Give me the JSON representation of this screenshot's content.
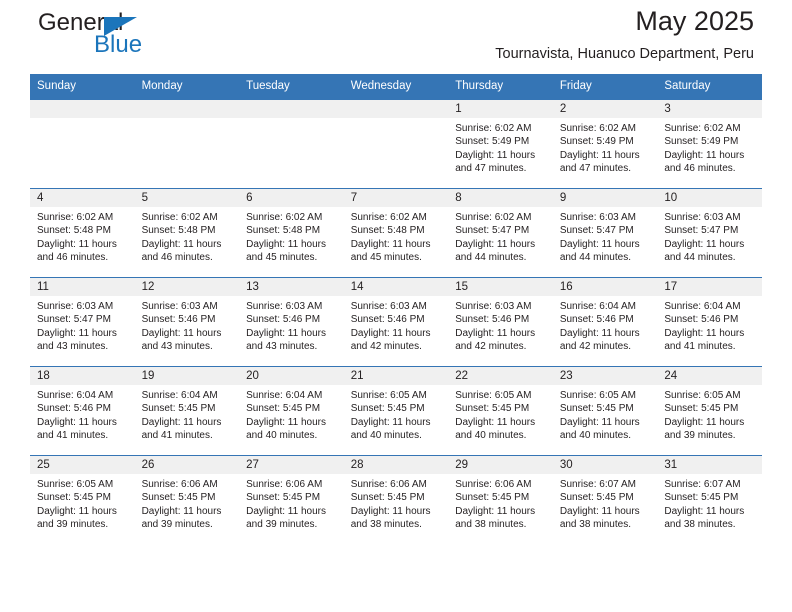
{
  "brand": {
    "name_dark": "General",
    "name_blue": "Blue",
    "accent_color": "#1b75bb"
  },
  "header": {
    "title": "May 2025",
    "subtitle": "Tournavista, Huanuco Department, Peru"
  },
  "theme": {
    "header_blue": "#3575b5",
    "daynum_band": "#f0f0f0",
    "text": "#231f20"
  },
  "calendar": {
    "day_headers": [
      "Sunday",
      "Monday",
      "Tuesday",
      "Wednesday",
      "Thursday",
      "Friday",
      "Saturday"
    ],
    "labels": {
      "sunrise": "Sunrise:",
      "sunset": "Sunset:",
      "daylight": "Daylight:"
    },
    "weeks": [
      [
        {
          "day": "",
          "sunrise": "",
          "sunset": "",
          "daylight_line1": "",
          "daylight_line2": "",
          "empty": true
        },
        {
          "day": "",
          "sunrise": "",
          "sunset": "",
          "daylight_line1": "",
          "daylight_line2": "",
          "empty": true
        },
        {
          "day": "",
          "sunrise": "",
          "sunset": "",
          "daylight_line1": "",
          "daylight_line2": "",
          "empty": true
        },
        {
          "day": "",
          "sunrise": "",
          "sunset": "",
          "daylight_line1": "",
          "daylight_line2": "",
          "empty": true
        },
        {
          "day": "1",
          "sunrise": "Sunrise: 6:02 AM",
          "sunset": "Sunset: 5:49 PM",
          "daylight_line1": "Daylight: 11 hours",
          "daylight_line2": "and 47 minutes."
        },
        {
          "day": "2",
          "sunrise": "Sunrise: 6:02 AM",
          "sunset": "Sunset: 5:49 PM",
          "daylight_line1": "Daylight: 11 hours",
          "daylight_line2": "and 47 minutes."
        },
        {
          "day": "3",
          "sunrise": "Sunrise: 6:02 AM",
          "sunset": "Sunset: 5:49 PM",
          "daylight_line1": "Daylight: 11 hours",
          "daylight_line2": "and 46 minutes."
        }
      ],
      [
        {
          "day": "4",
          "sunrise": "Sunrise: 6:02 AM",
          "sunset": "Sunset: 5:48 PM",
          "daylight_line1": "Daylight: 11 hours",
          "daylight_line2": "and 46 minutes."
        },
        {
          "day": "5",
          "sunrise": "Sunrise: 6:02 AM",
          "sunset": "Sunset: 5:48 PM",
          "daylight_line1": "Daylight: 11 hours",
          "daylight_line2": "and 46 minutes."
        },
        {
          "day": "6",
          "sunrise": "Sunrise: 6:02 AM",
          "sunset": "Sunset: 5:48 PM",
          "daylight_line1": "Daylight: 11 hours",
          "daylight_line2": "and 45 minutes."
        },
        {
          "day": "7",
          "sunrise": "Sunrise: 6:02 AM",
          "sunset": "Sunset: 5:48 PM",
          "daylight_line1": "Daylight: 11 hours",
          "daylight_line2": "and 45 minutes."
        },
        {
          "day": "8",
          "sunrise": "Sunrise: 6:02 AM",
          "sunset": "Sunset: 5:47 PM",
          "daylight_line1": "Daylight: 11 hours",
          "daylight_line2": "and 44 minutes."
        },
        {
          "day": "9",
          "sunrise": "Sunrise: 6:03 AM",
          "sunset": "Sunset: 5:47 PM",
          "daylight_line1": "Daylight: 11 hours",
          "daylight_line2": "and 44 minutes."
        },
        {
          "day": "10",
          "sunrise": "Sunrise: 6:03 AM",
          "sunset": "Sunset: 5:47 PM",
          "daylight_line1": "Daylight: 11 hours",
          "daylight_line2": "and 44 minutes."
        }
      ],
      [
        {
          "day": "11",
          "sunrise": "Sunrise: 6:03 AM",
          "sunset": "Sunset: 5:47 PM",
          "daylight_line1": "Daylight: 11 hours",
          "daylight_line2": "and 43 minutes."
        },
        {
          "day": "12",
          "sunrise": "Sunrise: 6:03 AM",
          "sunset": "Sunset: 5:46 PM",
          "daylight_line1": "Daylight: 11 hours",
          "daylight_line2": "and 43 minutes."
        },
        {
          "day": "13",
          "sunrise": "Sunrise: 6:03 AM",
          "sunset": "Sunset: 5:46 PM",
          "daylight_line1": "Daylight: 11 hours",
          "daylight_line2": "and 43 minutes."
        },
        {
          "day": "14",
          "sunrise": "Sunrise: 6:03 AM",
          "sunset": "Sunset: 5:46 PM",
          "daylight_line1": "Daylight: 11 hours",
          "daylight_line2": "and 42 minutes."
        },
        {
          "day": "15",
          "sunrise": "Sunrise: 6:03 AM",
          "sunset": "Sunset: 5:46 PM",
          "daylight_line1": "Daylight: 11 hours",
          "daylight_line2": "and 42 minutes."
        },
        {
          "day": "16",
          "sunrise": "Sunrise: 6:04 AM",
          "sunset": "Sunset: 5:46 PM",
          "daylight_line1": "Daylight: 11 hours",
          "daylight_line2": "and 42 minutes."
        },
        {
          "day": "17",
          "sunrise": "Sunrise: 6:04 AM",
          "sunset": "Sunset: 5:46 PM",
          "daylight_line1": "Daylight: 11 hours",
          "daylight_line2": "and 41 minutes."
        }
      ],
      [
        {
          "day": "18",
          "sunrise": "Sunrise: 6:04 AM",
          "sunset": "Sunset: 5:46 PM",
          "daylight_line1": "Daylight: 11 hours",
          "daylight_line2": "and 41 minutes."
        },
        {
          "day": "19",
          "sunrise": "Sunrise: 6:04 AM",
          "sunset": "Sunset: 5:45 PM",
          "daylight_line1": "Daylight: 11 hours",
          "daylight_line2": "and 41 minutes."
        },
        {
          "day": "20",
          "sunrise": "Sunrise: 6:04 AM",
          "sunset": "Sunset: 5:45 PM",
          "daylight_line1": "Daylight: 11 hours",
          "daylight_line2": "and 40 minutes."
        },
        {
          "day": "21",
          "sunrise": "Sunrise: 6:05 AM",
          "sunset": "Sunset: 5:45 PM",
          "daylight_line1": "Daylight: 11 hours",
          "daylight_line2": "and 40 minutes."
        },
        {
          "day": "22",
          "sunrise": "Sunrise: 6:05 AM",
          "sunset": "Sunset: 5:45 PM",
          "daylight_line1": "Daylight: 11 hours",
          "daylight_line2": "and 40 minutes."
        },
        {
          "day": "23",
          "sunrise": "Sunrise: 6:05 AM",
          "sunset": "Sunset: 5:45 PM",
          "daylight_line1": "Daylight: 11 hours",
          "daylight_line2": "and 40 minutes."
        },
        {
          "day": "24",
          "sunrise": "Sunrise: 6:05 AM",
          "sunset": "Sunset: 5:45 PM",
          "daylight_line1": "Daylight: 11 hours",
          "daylight_line2": "and 39 minutes."
        }
      ],
      [
        {
          "day": "25",
          "sunrise": "Sunrise: 6:05 AM",
          "sunset": "Sunset: 5:45 PM",
          "daylight_line1": "Daylight: 11 hours",
          "daylight_line2": "and 39 minutes."
        },
        {
          "day": "26",
          "sunrise": "Sunrise: 6:06 AM",
          "sunset": "Sunset: 5:45 PM",
          "daylight_line1": "Daylight: 11 hours",
          "daylight_line2": "and 39 minutes."
        },
        {
          "day": "27",
          "sunrise": "Sunrise: 6:06 AM",
          "sunset": "Sunset: 5:45 PM",
          "daylight_line1": "Daylight: 11 hours",
          "daylight_line2": "and 39 minutes."
        },
        {
          "day": "28",
          "sunrise": "Sunrise: 6:06 AM",
          "sunset": "Sunset: 5:45 PM",
          "daylight_line1": "Daylight: 11 hours",
          "daylight_line2": "and 38 minutes."
        },
        {
          "day": "29",
          "sunrise": "Sunrise: 6:06 AM",
          "sunset": "Sunset: 5:45 PM",
          "daylight_line1": "Daylight: 11 hours",
          "daylight_line2": "and 38 minutes."
        },
        {
          "day": "30",
          "sunrise": "Sunrise: 6:07 AM",
          "sunset": "Sunset: 5:45 PM",
          "daylight_line1": "Daylight: 11 hours",
          "daylight_line2": "and 38 minutes."
        },
        {
          "day": "31",
          "sunrise": "Sunrise: 6:07 AM",
          "sunset": "Sunset: 5:45 PM",
          "daylight_line1": "Daylight: 11 hours",
          "daylight_line2": "and 38 minutes."
        }
      ]
    ]
  }
}
